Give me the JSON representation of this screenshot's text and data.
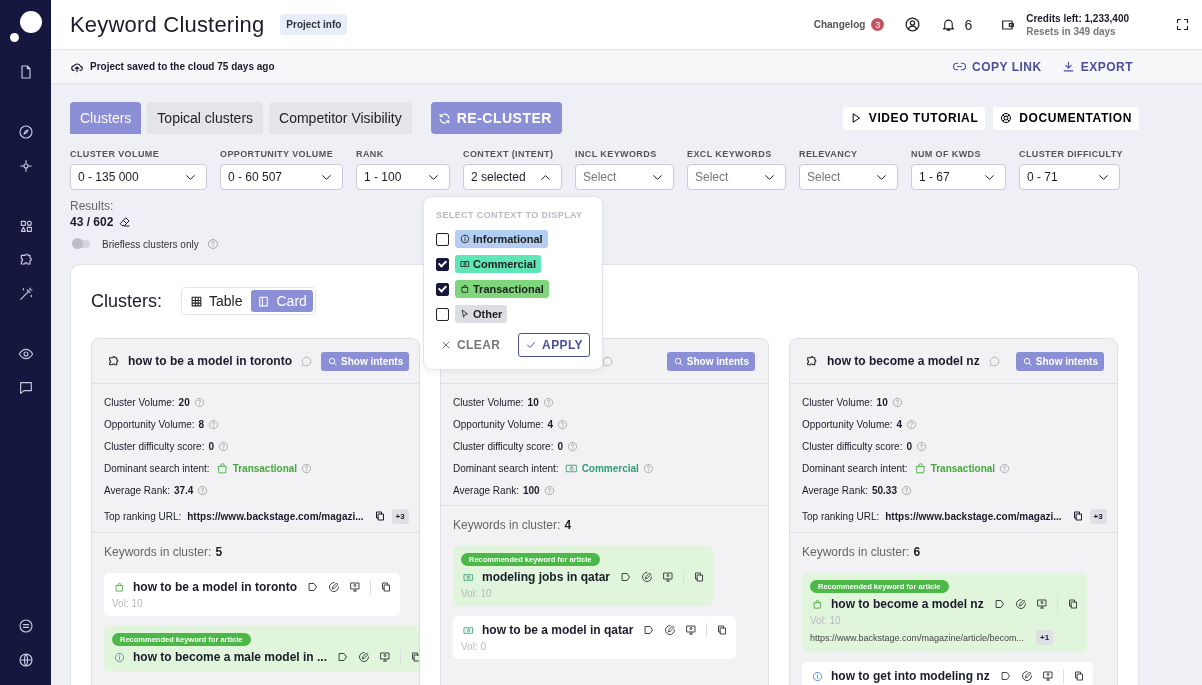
{
  "header": {
    "title": "Keyword Clustering",
    "badge": "Project info",
    "changelog": "Changelog",
    "changelog_count": "3",
    "notifications": "6",
    "credits": "Credits left: 1,233,400",
    "resets": "Resets in 349 days"
  },
  "save_bar": {
    "status": "Project saved to the cloud 75 days ago",
    "actions": [
      {
        "kind": "link",
        "label": "COPY LINK"
      },
      {
        "kind": "export",
        "label": "EXPORT"
      }
    ]
  },
  "tabs": [
    {
      "label": "Clusters",
      "selected": true
    },
    {
      "label": "Topical clusters",
      "selected": false
    },
    {
      "label": "Competitor Visibility",
      "selected": false
    }
  ],
  "recluster": "RE-CLUSTER",
  "help_buttons": [
    {
      "kind": "video",
      "label": "VIDEO TUTORIAL"
    },
    {
      "kind": "docs",
      "label": "DOCUMENTATION"
    }
  ],
  "filters": [
    {
      "label": "CLUSTER VOLUME",
      "value": "0 - 135 000",
      "expanded": false
    },
    {
      "label": "OPPORTUNITY VOLUME",
      "value": "0 - 60 507",
      "expanded": false
    },
    {
      "label": "RANK",
      "value": "1 - 100",
      "expanded": false
    },
    {
      "label": "CONTEXT (INTENT)",
      "value": "2 selected",
      "expanded": true
    },
    {
      "label": "INCL KEYWORDS",
      "placeholder": "Select",
      "expanded": false
    },
    {
      "label": "EXCL KEYWORDS",
      "placeholder": "Select",
      "expanded": false
    },
    {
      "label": "RELEVANCY",
      "placeholder": "Select",
      "expanded": false
    },
    {
      "label": "NUM OF KWDS",
      "value": "1 - 67",
      "expanded": false
    },
    {
      "label": "CLUSTER DIFFICULTY",
      "value": "0 - 71",
      "expanded": false
    }
  ],
  "results": {
    "label": "Results:",
    "value": "43 / 602"
  },
  "briefless": {
    "label": "Briefless clusters only",
    "on": false
  },
  "context_menu": {
    "heading": "SELECT CONTEXT TO DISPLAY",
    "options": [
      {
        "label": "Informational",
        "kind": "informational",
        "checked": false,
        "color": "#b4cdf2"
      },
      {
        "label": "Commercial",
        "kind": "commercial",
        "checked": true,
        "color": "#5fe6b6"
      },
      {
        "label": "Transactional",
        "kind": "transactional",
        "checked": true,
        "color": "#7fd67b"
      },
      {
        "label": "Other",
        "kind": "other",
        "checked": false,
        "color": "#dcdde2"
      }
    ],
    "clear": "CLEAR",
    "apply": "APPLY"
  },
  "panel": {
    "title": "Clusters:",
    "views": [
      {
        "label": "Table",
        "kind": "table",
        "selected": false
      },
      {
        "label": "Card",
        "kind": "card",
        "selected": true
      }
    ]
  },
  "cards": [
    {
      "title": "how to be a model in toronto",
      "action": "Show intents",
      "stats": [
        {
          "label": "Cluster Volume:",
          "value": "20"
        },
        {
          "label": "Opportunity Volume:",
          "value": "8"
        },
        {
          "label": "Cluster difficulty score:",
          "value": "0"
        },
        {
          "label": "Dominant search intent:",
          "kind": "transactional",
          "value": "Transactional"
        },
        {
          "label": "Average Rank:",
          "value": "37.4"
        }
      ],
      "url_label": "Top ranking URL:",
      "url": "https://www.backstage.com/magazi...",
      "url_more": "+3",
      "keywords_label": "Keywords in cluster:",
      "keywords_count": "5",
      "keywords": [
        {
          "text": "how to be a model in toronto",
          "kind": "transactional",
          "recommended": false,
          "vol": "Vol: 10"
        },
        {
          "text": "how to become a male model in ...",
          "kind": "informational",
          "recommended": true,
          "badge": "Recommended keyword for article"
        }
      ]
    },
    {
      "action": "Show intents",
      "stats": [
        {
          "label": "Cluster Volume:",
          "value": "10"
        },
        {
          "label": "Opportunity Volume:",
          "value": "4"
        },
        {
          "label": "Cluster difficulty score:",
          "value": "0"
        },
        {
          "label": "Dominant search intent:",
          "kind": "commercial",
          "value": "Commercial"
        },
        {
          "label": "Average Rank:",
          "value": "100"
        }
      ],
      "keywords_label": "Keywords in cluster:",
      "keywords_count": "4",
      "keywords": [
        {
          "text": "modeling jobs in qatar",
          "kind": "commercial",
          "recommended": true,
          "badge": "Recommended keyword for article",
          "vol": "Vol: 10"
        },
        {
          "text": "how to be a model in qatar",
          "kind": "commercial",
          "recommended": false,
          "vol": "Vol: 0"
        }
      ]
    },
    {
      "title": "how to become a model nz",
      "action": "Show intents",
      "stats": [
        {
          "label": "Cluster Volume:",
          "value": "10"
        },
        {
          "label": "Opportunity Volume:",
          "value": "4"
        },
        {
          "label": "Cluster difficulty score:",
          "value": "0"
        },
        {
          "label": "Dominant search intent:",
          "kind": "transactional",
          "value": "Transactional"
        },
        {
          "label": "Average Rank:",
          "value": "50.33"
        }
      ],
      "url_label": "Top ranking URL:",
      "url": "https://www.backstage.com/magazi...",
      "url_more": "+3",
      "keywords_label": "Keywords in cluster:",
      "keywords_count": "6",
      "keywords": [
        {
          "text": "how to become a model nz",
          "kind": "transactional",
          "recommended": true,
          "badge": "Recommended keyword for article",
          "vol": "Vol: 10",
          "url": "https://www.backstage.com/magazine/article/becom...",
          "url_more": "+1"
        },
        {
          "text": "how to get into modeling nz",
          "kind": "informational",
          "recommended": false
        }
      ]
    }
  ]
}
